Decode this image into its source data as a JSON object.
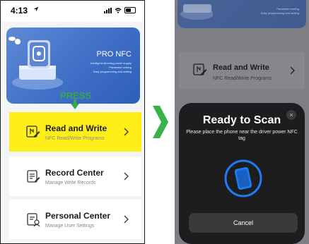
{
  "left_phone": {
    "status": {
      "time": "4:13"
    },
    "hero": {
      "title": "PRO NFC",
      "line1": "Intelligent dimming power supply",
      "line2": "Parameter setting",
      "line3": "Easy programming and setting"
    },
    "press_label": "PRESS",
    "menu": [
      {
        "title": "Read and Write",
        "subtitle": "NFC Read/Write Programs",
        "icon": "nfc-read-write-icon",
        "highlighted": true
      },
      {
        "title": "Record Center",
        "subtitle": "Manage Write Records",
        "icon": "record-document-icon",
        "highlighted": false
      },
      {
        "title": "Personal Center",
        "subtitle": "Manage User Settings",
        "icon": "user-settings-icon",
        "highlighted": false
      }
    ],
    "colors": {
      "highlight": "#ffee1a",
      "hero_blue": "#3f6ec6",
      "press_green": "#3aa64a"
    }
  },
  "transition_arrow": {
    "icon": "chevron-right-icon",
    "color": "#37b34a"
  },
  "right_phone": {
    "hero": {
      "line1": "Parameter setting",
      "line2": "Easy programming and setting"
    },
    "card": {
      "title": "Read and Write",
      "subtitle": "NFC Read/Write Programs"
    },
    "sheet": {
      "title": "Ready to Scan",
      "message": "Please place the phone near the driver power NFC tag",
      "cancel_label": "Cancel",
      "close_glyph": "×",
      "scan_icon": "phone-scan-icon",
      "accent": "#1d7cf2"
    }
  }
}
